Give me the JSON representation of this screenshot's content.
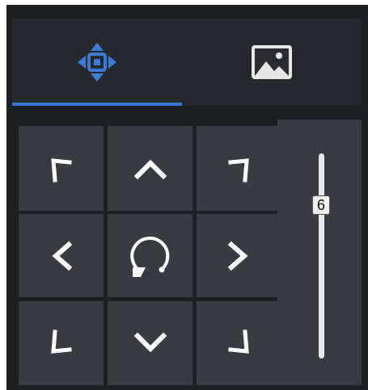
{
  "tabs": [
    {
      "name": "ptz",
      "icon": "move-arrows-icon",
      "active": true
    },
    {
      "name": "image",
      "icon": "image-icon",
      "active": false
    }
  ],
  "colors": {
    "accent": "#3a7bd5",
    "panel_bg": "#1d1f23",
    "button_bg": "#383b41",
    "icon": "#ffffff"
  },
  "direction_pad": [
    {
      "id": "up-left",
      "icon": "arrow-up-left-icon"
    },
    {
      "id": "up",
      "icon": "chevron-up-icon"
    },
    {
      "id": "up-right",
      "icon": "arrow-up-right-icon"
    },
    {
      "id": "left",
      "icon": "chevron-left-icon"
    },
    {
      "id": "center",
      "icon": "rotate-icon"
    },
    {
      "id": "right",
      "icon": "chevron-right-icon"
    },
    {
      "id": "down-left",
      "icon": "arrow-down-left-icon"
    },
    {
      "id": "down",
      "icon": "chevron-down-icon"
    },
    {
      "id": "down-right",
      "icon": "arrow-down-right-icon"
    }
  ],
  "speed_slider": {
    "value": "6",
    "level": 0.75
  }
}
